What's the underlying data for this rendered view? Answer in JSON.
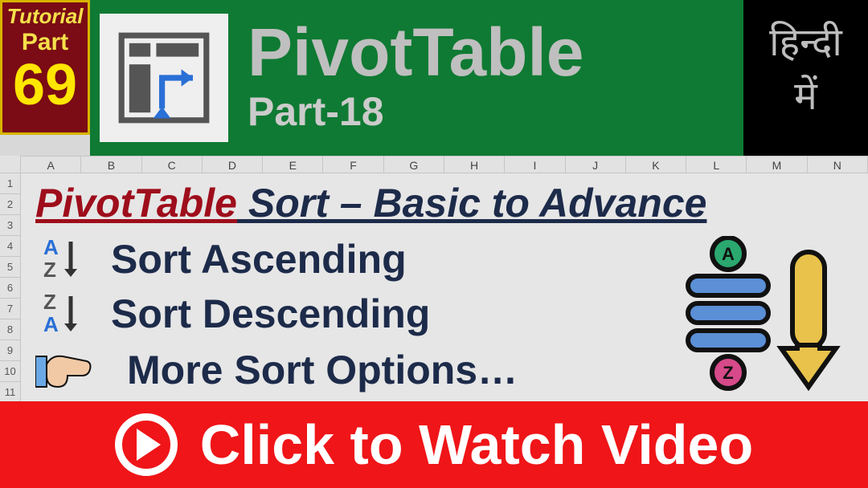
{
  "badge": {
    "line1": "Tutorial",
    "line2": "Part",
    "number": "69"
  },
  "banner": {
    "title": "PivotTable",
    "subtitle": "Part-18"
  },
  "hindi": {
    "line1": "हिन्दी",
    "line2": "में"
  },
  "columns": [
    "A",
    "B",
    "C",
    "D",
    "E",
    "F",
    "G",
    "H",
    "I",
    "J",
    "K",
    "L",
    "M",
    "N"
  ],
  "rows": [
    "",
    "1",
    "2",
    "3",
    "4",
    "5",
    "6",
    "7",
    "8",
    "9",
    "10",
    "11"
  ],
  "heading": {
    "highlight": "PivotTable",
    "rest": " Sort – Basic to Advance"
  },
  "bullets": {
    "b1": "Sort Ascending",
    "b2": "Sort Descending",
    "b3": "More Sort Options…"
  },
  "cta": {
    "label": "Click to Watch Video"
  }
}
